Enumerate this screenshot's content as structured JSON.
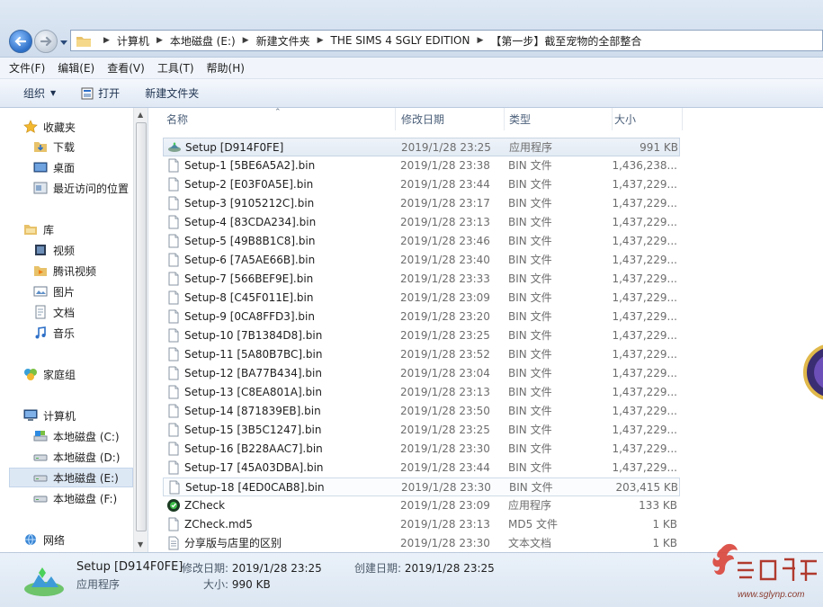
{
  "address": {
    "segments": [
      "计算机",
      "本地磁盘 (E:)",
      "新建文件夹",
      "THE SIMS 4 SGLY EDITION",
      "【第一步】截至宠物的全部整合"
    ]
  },
  "menu": [
    "文件(F)",
    "编辑(E)",
    "查看(V)",
    "工具(T)",
    "帮助(H)"
  ],
  "toolbar": {
    "organize": "组织",
    "open": "打开",
    "new_folder": "新建文件夹"
  },
  "sidebar": {
    "favorites": "收藏夹",
    "downloads": "下载",
    "desktop": "桌面",
    "recent": "最近访问的位置",
    "libraries": "库",
    "videos": "视频",
    "tencent_video": "腾讯视频",
    "pictures": "图片",
    "documents": "文档",
    "music": "音乐",
    "homegroup": "家庭组",
    "computer": "计算机",
    "drive_c": "本地磁盘 (C:)",
    "drive_d": "本地磁盘 (D:)",
    "drive_e": "本地磁盘 (E:)",
    "drive_f": "本地磁盘 (F:)",
    "network": "网络"
  },
  "columns": {
    "name": "名称",
    "date": "修改日期",
    "type": "类型",
    "size": "大小"
  },
  "files": [
    {
      "name": "Setup [D914F0FE]",
      "date": "2019/1/28 23:25",
      "type": "应用程序",
      "size": "991 KB",
      "icon": "sims-exe-icon"
    },
    {
      "name": "Setup-1 [5BE6A5A2].bin",
      "date": "2019/1/28 23:38",
      "type": "BIN 文件",
      "size": "1,436,238...",
      "icon": "file-icon"
    },
    {
      "name": "Setup-2 [E03F0A5E].bin",
      "date": "2019/1/28 23:44",
      "type": "BIN 文件",
      "size": "1,437,229...",
      "icon": "file-icon"
    },
    {
      "name": "Setup-3 [9105212C].bin",
      "date": "2019/1/28 23:17",
      "type": "BIN 文件",
      "size": "1,437,229...",
      "icon": "file-icon"
    },
    {
      "name": "Setup-4 [83CDA234].bin",
      "date": "2019/1/28 23:13",
      "type": "BIN 文件",
      "size": "1,437,229...",
      "icon": "file-icon"
    },
    {
      "name": "Setup-5 [49B8B1C8].bin",
      "date": "2019/1/28 23:46",
      "type": "BIN 文件",
      "size": "1,437,229...",
      "icon": "file-icon"
    },
    {
      "name": "Setup-6 [7A5AE66B].bin",
      "date": "2019/1/28 23:40",
      "type": "BIN 文件",
      "size": "1,437,229...",
      "icon": "file-icon"
    },
    {
      "name": "Setup-7 [566BEF9E].bin",
      "date": "2019/1/28 23:33",
      "type": "BIN 文件",
      "size": "1,437,229...",
      "icon": "file-icon"
    },
    {
      "name": "Setup-8 [C45F011E].bin",
      "date": "2019/1/28 23:09",
      "type": "BIN 文件",
      "size": "1,437,229...",
      "icon": "file-icon"
    },
    {
      "name": "Setup-9 [0CA8FFD3].bin",
      "date": "2019/1/28 23:20",
      "type": "BIN 文件",
      "size": "1,437,229...",
      "icon": "file-icon"
    },
    {
      "name": "Setup-10 [7B1384D8].bin",
      "date": "2019/1/28 23:25",
      "type": "BIN 文件",
      "size": "1,437,229...",
      "icon": "file-icon"
    },
    {
      "name": "Setup-11 [5A80B7BC].bin",
      "date": "2019/1/28 23:52",
      "type": "BIN 文件",
      "size": "1,437,229...",
      "icon": "file-icon"
    },
    {
      "name": "Setup-12 [BA77B434].bin",
      "date": "2019/1/28 23:04",
      "type": "BIN 文件",
      "size": "1,437,229...",
      "icon": "file-icon"
    },
    {
      "name": "Setup-13 [C8EA801A].bin",
      "date": "2019/1/28 23:13",
      "type": "BIN 文件",
      "size": "1,437,229...",
      "icon": "file-icon"
    },
    {
      "name": "Setup-14 [871839EB].bin",
      "date": "2019/1/28 23:50",
      "type": "BIN 文件",
      "size": "1,437,229...",
      "icon": "file-icon"
    },
    {
      "name": "Setup-15 [3B5C1247].bin",
      "date": "2019/1/28 23:25",
      "type": "BIN 文件",
      "size": "1,437,229...",
      "icon": "file-icon"
    },
    {
      "name": "Setup-16 [B228AAC7].bin",
      "date": "2019/1/28 23:30",
      "type": "BIN 文件",
      "size": "1,437,229...",
      "icon": "file-icon"
    },
    {
      "name": "Setup-17 [45A03DBA].bin",
      "date": "2019/1/28 23:44",
      "type": "BIN 文件",
      "size": "1,437,229...",
      "icon": "file-icon"
    },
    {
      "name": "Setup-18 [4ED0CAB8].bin",
      "date": "2019/1/28 23:30",
      "type": "BIN 文件",
      "size": "203,415 KB",
      "icon": "file-icon"
    },
    {
      "name": "ZCheck",
      "date": "2019/1/28 23:09",
      "type": "应用程序",
      "size": "133 KB",
      "icon": "zcheck-icon"
    },
    {
      "name": "ZCheck.md5",
      "date": "2019/1/28 23:13",
      "type": "MD5 文件",
      "size": "1 KB",
      "icon": "file-icon"
    },
    {
      "name": "分享版与店里的区别",
      "date": "2019/1/28 23:30",
      "type": "文本文档",
      "size": "1 KB",
      "icon": "text-doc-icon"
    }
  ],
  "details": {
    "name": "Setup [D914F0FE]",
    "type": "应用程序",
    "modified_label": "修改日期:",
    "modified": "2019/1/28 23:25",
    "size_label": "大小:",
    "size": "990 KB",
    "created_label": "创建日期:",
    "created": "2019/1/28 23:25"
  },
  "watermark": {
    "site": "www.sglynp.com"
  },
  "colors": {
    "selection": "#dde8f5",
    "accent": "#2d6fc7"
  }
}
